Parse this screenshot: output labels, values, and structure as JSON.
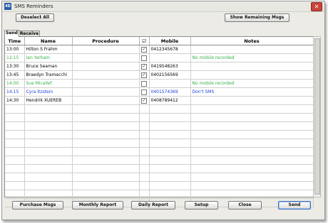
{
  "window": {
    "title": "SMS Reminders",
    "icon_text": "4D",
    "close_glyph": "✕"
  },
  "toolbar": {
    "deselect_all": "Deselect All",
    "show_remaining": "Show Remaining Msgs"
  },
  "tabs": [
    {
      "label": "Send"
    },
    {
      "label": "Receive"
    }
  ],
  "table": {
    "headers": {
      "time": "Time",
      "name": "Name",
      "procedure": "Procedure",
      "check": "☑",
      "mobile": "Mobile",
      "notes": "Notes"
    },
    "rows": [
      {
        "time": "13:00",
        "name": "Hilton S Frahm",
        "procedure": "",
        "checked": true,
        "mobile": "0412345678",
        "notes": "",
        "color": "#000000"
      },
      {
        "time": "12:15",
        "name": "Ian Yarham",
        "procedure": "",
        "checked": false,
        "mobile": "",
        "notes": "No mobile recorded",
        "color": "#33b24a"
      },
      {
        "time": "13:30",
        "name": "Bruce Seaman",
        "procedure": "",
        "checked": true,
        "mobile": "0419548263",
        "notes": "",
        "color": "#000000"
      },
      {
        "time": "13:45",
        "name": "Braedyn Tramacchi",
        "procedure": "",
        "checked": true,
        "mobile": "0402156569",
        "notes": "",
        "color": "#000000"
      },
      {
        "time": "14:00",
        "name": "Sue Micallef",
        "procedure": "",
        "checked": false,
        "mobile": "",
        "notes": "No mobile recorded",
        "color": "#33b24a"
      },
      {
        "time": "14:15",
        "name": "Cyra Itzstein",
        "procedure": "",
        "checked": false,
        "mobile": "0401574369",
        "notes": "Don't  SMS",
        "color": "#1f3fd6"
      },
      {
        "time": "14:30",
        "name": "Hendrik XUEREB",
        "procedure": "",
        "checked": true,
        "mobile": "0408789412",
        "notes": "",
        "color": "#000000"
      }
    ],
    "empty_rows": 12
  },
  "footer": {
    "purchase": "Purchase Msgs",
    "monthly": "Monthly Report",
    "daily": "Daily Report",
    "setup": "Setup",
    "close": "Close",
    "send": "Send"
  }
}
